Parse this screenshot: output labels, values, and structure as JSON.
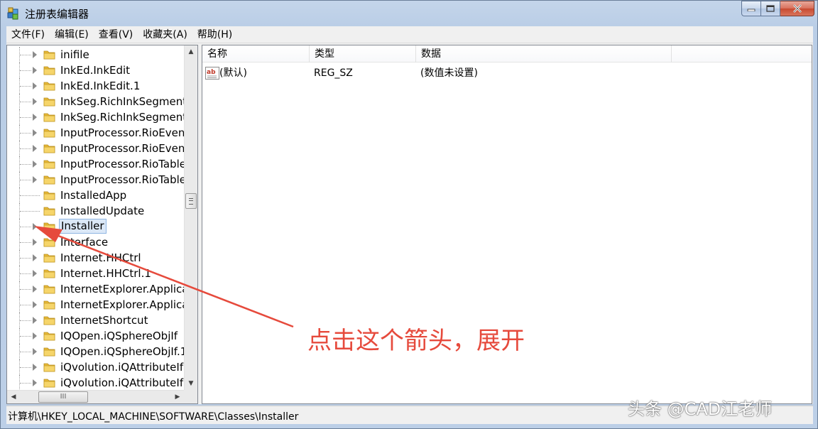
{
  "window": {
    "title": "注册表编辑器"
  },
  "menu": [
    "文件(F)",
    "编辑(E)",
    "查看(V)",
    "收藏夹(A)",
    "帮助(H)"
  ],
  "tree": {
    "items": [
      {
        "label": "inifile",
        "expandable": true
      },
      {
        "label": "InkEd.InkEdit",
        "expandable": true
      },
      {
        "label": "InkEd.InkEdit.1",
        "expandable": true
      },
      {
        "label": "InkSeg.RichInkSegment",
        "expandable": true
      },
      {
        "label": "InkSeg.RichInkSegment",
        "expandable": true
      },
      {
        "label": "InputProcessor.RioEven",
        "expandable": true
      },
      {
        "label": "InputProcessor.RioEven",
        "expandable": true
      },
      {
        "label": "InputProcessor.RioTable",
        "expandable": true
      },
      {
        "label": "InputProcessor.RioTable",
        "expandable": true
      },
      {
        "label": "InstalledApp",
        "expandable": false
      },
      {
        "label": "InstalledUpdate",
        "expandable": false
      },
      {
        "label": "Installer",
        "expandable": true,
        "selected": true
      },
      {
        "label": "Interface",
        "expandable": true
      },
      {
        "label": "Internet.HHCtrl",
        "expandable": true
      },
      {
        "label": "Internet.HHCtrl.1",
        "expandable": true
      },
      {
        "label": "InternetExplorer.Applica",
        "expandable": true
      },
      {
        "label": "InternetExplorer.Applica",
        "expandable": true
      },
      {
        "label": "InternetShortcut",
        "expandable": true
      },
      {
        "label": "IQOpen.iQSphereObjIf",
        "expandable": true
      },
      {
        "label": "IQOpen.iQSphereObjIf.1",
        "expandable": true
      },
      {
        "label": "iQvolution.iQAttributeIf",
        "expandable": true
      },
      {
        "label": "iQvolution.iQAttributeIf",
        "expandable": true
      }
    ],
    "hscroll_thumb_label": "III"
  },
  "list": {
    "columns": [
      "名称",
      "类型",
      "数据"
    ],
    "rows": [
      {
        "name": "(默认)",
        "type": "REG_SZ",
        "data": "(数值未设置)"
      }
    ]
  },
  "status": {
    "path": "计算机\\HKEY_LOCAL_MACHINE\\SOFTWARE\\Classes\\Installer"
  },
  "annotation": {
    "text": "点击这个箭头，展开",
    "color": "#e64a3c"
  },
  "watermark": {
    "text": "头条 @CAD江老师"
  }
}
